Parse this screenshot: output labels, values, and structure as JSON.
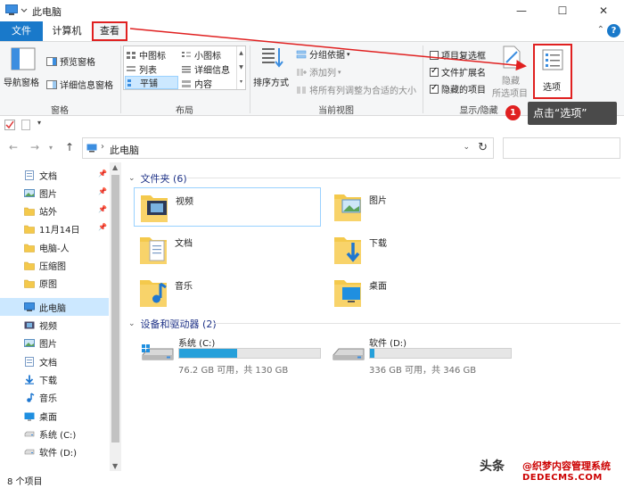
{
  "window": {
    "title": "此电脑",
    "minimize_glyph": "—",
    "maximize_glyph": "☐",
    "close_glyph": "✕"
  },
  "tabs": {
    "file": "文件",
    "computer": "计算机",
    "view": "查看",
    "help_glyph": "?"
  },
  "ribbon": {
    "panes": {
      "label": "窗格",
      "nav_pane": "导航窗格",
      "preview_pane": "预览窗格",
      "details_pane": "详细信息窗格"
    },
    "layout": {
      "label": "布局",
      "items": [
        "中图标",
        "小图标",
        "列表",
        "详细信息",
        "平铺",
        "内容"
      ]
    },
    "current_view": {
      "label": "当前视图",
      "sort_by": "排序方式",
      "group_by": "分组依据",
      "add_column": "添加列",
      "fit_columns": "将所有列调整为合适的大小"
    },
    "show_hide": {
      "label": "显示/隐藏",
      "item_checkboxes": "项目复选框",
      "file_extensions": "文件扩展名",
      "hidden_items": "隐藏的项目",
      "hide_selected_1": "隐藏",
      "hide_selected_2": "所选项目"
    },
    "options": "选项"
  },
  "address": {
    "path": "此电脑"
  },
  "nav": {
    "items": [
      {
        "label": "文档",
        "pinned": true
      },
      {
        "label": "图片",
        "pinned": true
      },
      {
        "label": "站外",
        "pinned": true
      },
      {
        "label": "11月14日",
        "pinned": true
      },
      {
        "label": "电脑-人",
        "pinned": false
      },
      {
        "label": "压缩图",
        "pinned": false
      },
      {
        "label": "原图",
        "pinned": false
      },
      {
        "label": "此电脑",
        "pinned": false
      },
      {
        "label": "视频",
        "pinned": false
      },
      {
        "label": "图片",
        "pinned": false
      },
      {
        "label": "文档",
        "pinned": false
      },
      {
        "label": "下载",
        "pinned": false
      },
      {
        "label": "音乐",
        "pinned": false
      },
      {
        "label": "桌面",
        "pinned": false
      },
      {
        "label": "系统 (C:)",
        "pinned": false
      },
      {
        "label": "软件 (D:)",
        "pinned": false
      }
    ]
  },
  "content": {
    "folders_header": "文件夹 (6)",
    "folders": [
      "视频",
      "图片",
      "文档",
      "下载",
      "音乐",
      "桌面"
    ],
    "devices_header": "设备和驱动器 (2)",
    "drives": [
      {
        "name": "系统 (C:)",
        "size_text": "76.2 GB 可用，共 130 GB",
        "used_fraction": 0.414
      },
      {
        "name": "软件 (D:)",
        "size_text": "336 GB 可用，共 346 GB",
        "used_fraction": 0.029
      }
    ]
  },
  "status": {
    "count": "8 个项目"
  },
  "annotation": {
    "step": "1",
    "tip": "点击“选项”"
  },
  "watermark": {
    "line1": "头条",
    "line2": "@织梦内容管理系统",
    "line3": "DEDECMS.COM"
  },
  "colors": {
    "accent": "#1979ca",
    "highlight_red": "#e02020",
    "drive_fill": "#26a0da",
    "folder_yellow": "#f4c94c"
  }
}
